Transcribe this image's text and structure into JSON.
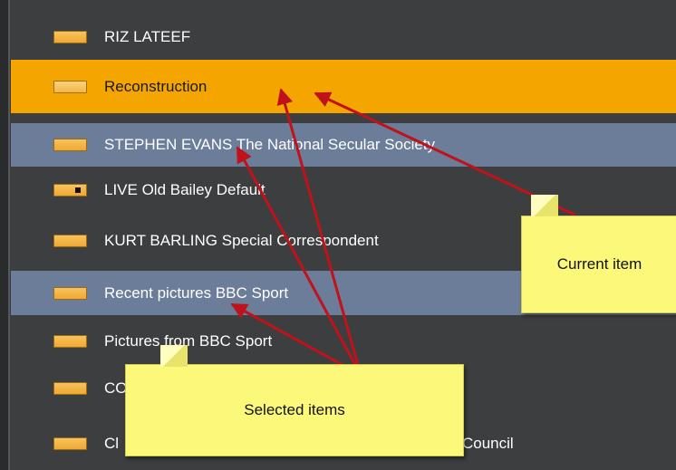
{
  "list": {
    "items": [
      {
        "label": "RIZ LATEEF",
        "state": "normal",
        "icon": "folder-icon"
      },
      {
        "label": "Reconstruction",
        "state": "current",
        "icon": "folder-icon"
      },
      {
        "label": "STEPHEN EVANS The National Secular Society",
        "state": "selected",
        "icon": "folder-icon"
      },
      {
        "label": "LIVE Old Bailey Default",
        "state": "normal",
        "icon": "live-icon"
      },
      {
        "label": "KURT BARLING Special Correspondent",
        "state": "normal",
        "icon": "folder-icon"
      },
      {
        "label": "Recent pictures BBC Sport",
        "state": "selected",
        "icon": "folder-icon"
      },
      {
        "label": "Pictures from BBC Sport",
        "state": "normal",
        "icon": "folder-icon"
      },
      {
        "label": "CONS",
        "state": "normal",
        "icon": "folder-icon"
      },
      {
        "label": "Cl",
        "state": "normal",
        "icon": "folder-icon"
      }
    ],
    "last_row_trailing_text": "Council"
  },
  "annotations": {
    "current_item": "Current item",
    "selected_items": "Selected items",
    "arrow_color": "#c0121a"
  },
  "colors": {
    "panel_bg": "#3d3e40",
    "current_bg": "#f5a500",
    "selected_bg": "#6b7d98",
    "note_bg": "#fcf97a"
  }
}
